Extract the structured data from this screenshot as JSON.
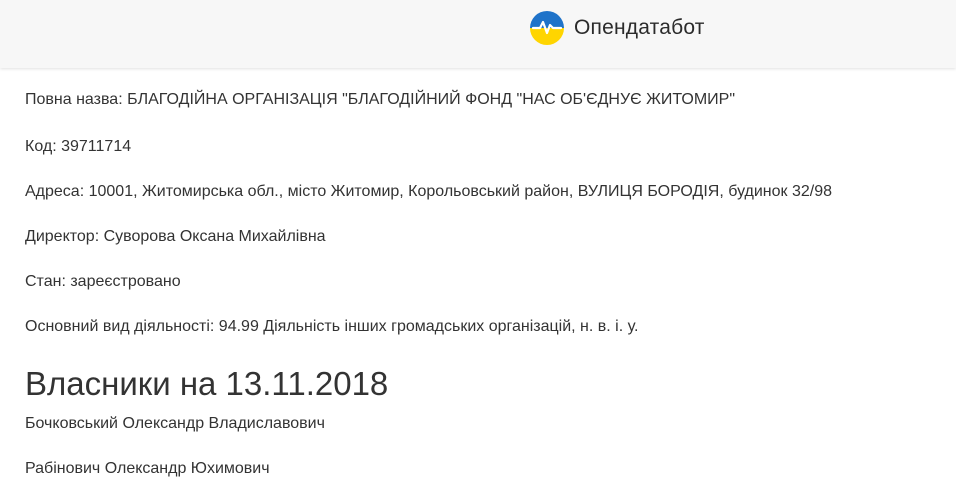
{
  "header": {
    "brand_name": "Опендатабот",
    "brand_colors": {
      "top": "#1f73c9",
      "bottom": "#ffd500",
      "pulse": "#1f73c9"
    },
    "logo_icon": "opendatabot-logo-icon"
  },
  "company": {
    "full_name_label": "Повна назва:",
    "full_name_value": "БЛАГОДІЙНА ОРГАНІЗАЦІЯ \"БЛАГОДІЙНИЙ ФОНД \"НАС ОБ'ЄДНУЄ ЖИТОМИР\"",
    "code_label": "Код:",
    "code_value": "39711714",
    "address_label": "Адреса:",
    "address_value": "10001, Житомирська обл., місто Житомир, Корольовський район, ВУЛИЦЯ БОРОДІЯ, будинок 32/98",
    "director_label": "Директор:",
    "director_value": "Суворова Оксана Михайлівна",
    "status_label": "Стан:",
    "status_value": "зареєстровано",
    "activity_label": "Основний вид діяльності:",
    "activity_value": "94.99 Діяльність інших громадських організацій, н. в. і. у."
  },
  "owners": {
    "title": "Власники на 13.11.2018",
    "items": [
      "Бочковський Олександр Владиславович",
      "Рабінович Олександр Юхимович"
    ]
  }
}
